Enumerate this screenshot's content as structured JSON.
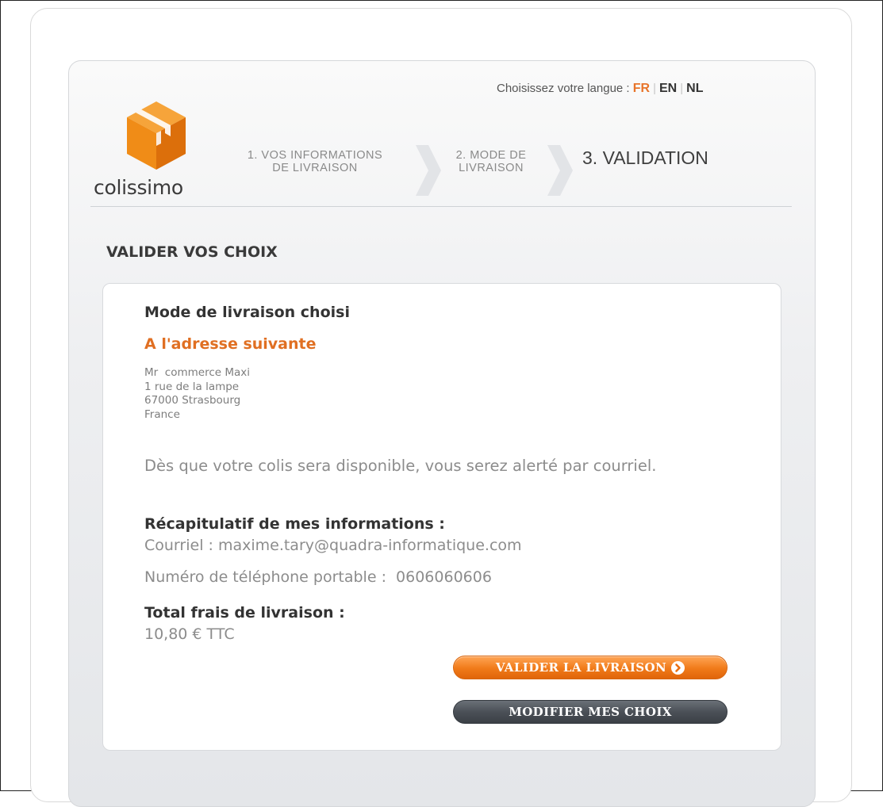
{
  "brand": {
    "name": "colissimo",
    "accent": "#e8742a"
  },
  "language": {
    "prompt": "Choisissez votre langue :",
    "options": [
      "FR",
      "EN",
      "NL"
    ],
    "active": "FR"
  },
  "steps": [
    {
      "line1": "1. VOS INFORMATIONS",
      "line2": "DE LIVRAISON"
    },
    {
      "line1": "2. MODE DE",
      "line2": "LIVRAISON"
    },
    {
      "label": "3. VALIDATION",
      "current": true
    }
  ],
  "section_title": "VALIDER VOS CHOIX",
  "delivery": {
    "mode_label": "Mode de livraison choisi",
    "mode_value": "A l'adresse suivante",
    "address": [
      "Mr  commerce Maxi",
      "1 rue de la lampe",
      "67000 Strasbourg",
      "France"
    ],
    "notice": "Dès que votre colis sera disponible, vous serez alerté par courriel."
  },
  "recap": {
    "label": "Récapitulatif de mes informations :",
    "email_line": "Courriel : maxime.tary@quadra-informatique.com",
    "phone_line": "Numéro de téléphone portable :  0606060606"
  },
  "total": {
    "label": "Total frais de livraison :",
    "value": "10,80 € TTC"
  },
  "buttons": {
    "validate": "VALIDER LA LIVRAISON",
    "modify": "MODIFIER MES CHOIX"
  },
  "icons": {
    "logo": "colissimo-cube-icon",
    "step_separator": "chevron-right-icon",
    "validate": "arrow-circle-right-icon"
  }
}
